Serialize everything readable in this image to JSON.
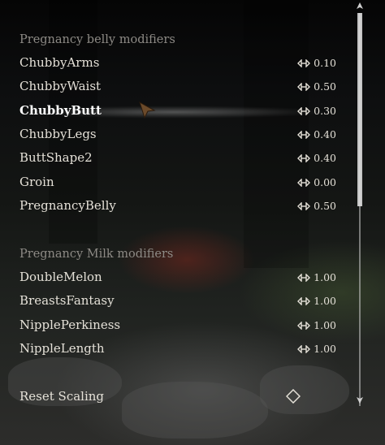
{
  "sections": [
    {
      "header": "Pregnancy belly modifiers",
      "items": [
        {
          "label": "ChubbyArms",
          "value": "0.10"
        },
        {
          "label": "ChubbyWaist",
          "value": "0.50"
        },
        {
          "label": "ChubbyButt",
          "value": "0.30",
          "selected": true
        },
        {
          "label": "ChubbyLegs",
          "value": "0.40"
        },
        {
          "label": "ButtShape2",
          "value": "0.40"
        },
        {
          "label": "Groin",
          "value": "0.00"
        },
        {
          "label": "PregnancyBelly",
          "value": "0.50"
        }
      ]
    },
    {
      "header": "Pregnancy Milk modifiers",
      "items": [
        {
          "label": "DoubleMelon",
          "value": "1.00"
        },
        {
          "label": "BreastsFantasy",
          "value": "1.00"
        },
        {
          "label": "NipplePerkiness",
          "value": "1.00"
        },
        {
          "label": "NippleLength",
          "value": "1.00"
        }
      ]
    }
  ],
  "reset": {
    "label": "Reset Scaling",
    "icon": "diamond-icon"
  },
  "icons": {
    "slider": "slider-arrows-icon",
    "cursor": "arrow-cursor-icon"
  },
  "colors": {
    "text": "#e5e1d8",
    "header": "#8d8a85"
  }
}
